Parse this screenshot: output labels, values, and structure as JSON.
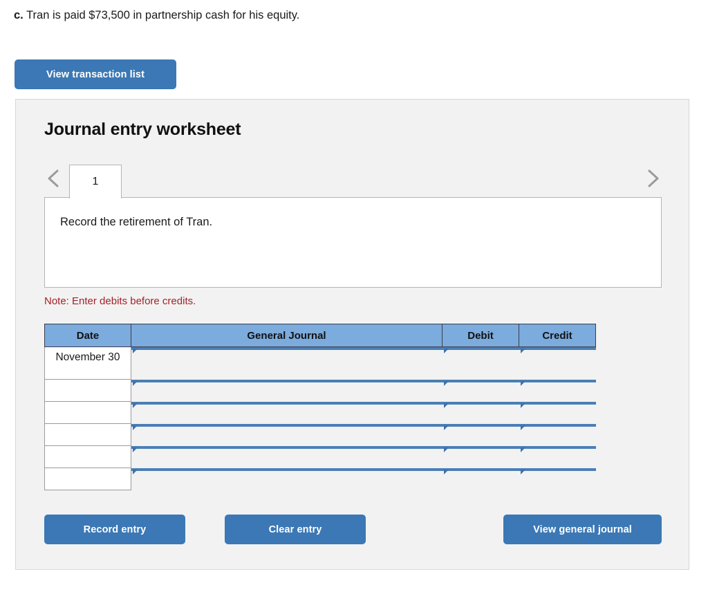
{
  "prompt": {
    "label": "c.",
    "text": "Tran is paid $73,500 in partnership cash for his equity."
  },
  "toolbar": {
    "view_transaction_list_label": "View transaction list"
  },
  "panel": {
    "title": "Journal entry worksheet",
    "tabs": [
      {
        "label": "1",
        "selected": true
      }
    ],
    "nav": {
      "prev_icon": "chevron-left-icon",
      "next_icon": "chevron-right-icon"
    },
    "instruction": "Record the retirement of Tran.",
    "note": "Note: Enter debits before credits."
  },
  "table": {
    "columns": [
      "Date",
      "General Journal",
      "Debit",
      "Credit"
    ],
    "rows": [
      {
        "date": "November 30",
        "general_journal": "",
        "debit": "",
        "credit": ""
      },
      {
        "date": "",
        "general_journal": "",
        "debit": "",
        "credit": ""
      },
      {
        "date": "",
        "general_journal": "",
        "debit": "",
        "credit": ""
      },
      {
        "date": "",
        "general_journal": "",
        "debit": "",
        "credit": ""
      },
      {
        "date": "",
        "general_journal": "",
        "debit": "",
        "credit": ""
      },
      {
        "date": "",
        "general_journal": "",
        "debit": "",
        "credit": ""
      }
    ]
  },
  "footer": {
    "record_entry_label": "Record entry",
    "clear_entry_label": "Clear entry",
    "view_general_journal_label": "View general journal"
  },
  "colors": {
    "button_blue": "#3b78b5",
    "header_blue": "#7cabdd",
    "input_border_blue": "#4a7fb5",
    "note_red": "#a52128",
    "panel_gray": "#f2f2f2"
  }
}
